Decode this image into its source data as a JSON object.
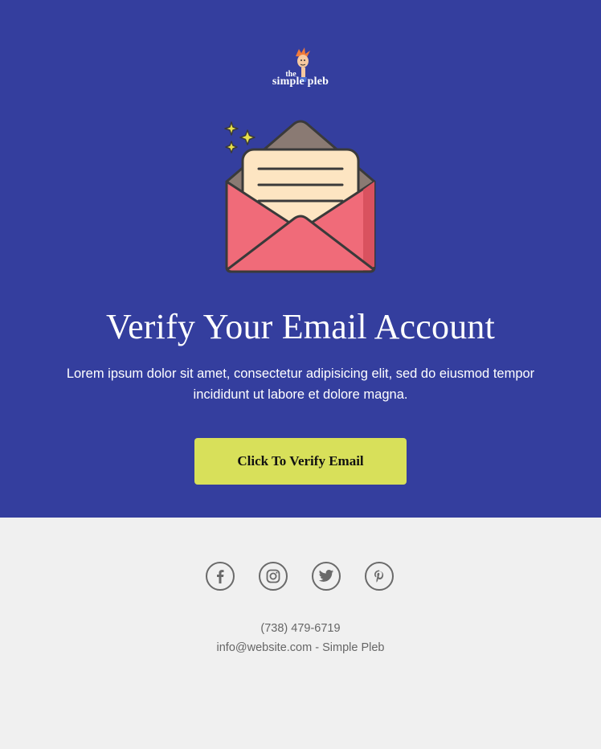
{
  "brand": {
    "logo_small": "the",
    "logo_big": "simple pleb"
  },
  "hero": {
    "title": "Verify Your Email Account",
    "body": "Lorem ipsum dolor sit amet, consectetur adipisicing elit, sed do eiusmod tempor incididunt ut labore et dolore magna.",
    "cta_label": "Click To Verify Email"
  },
  "footer": {
    "social": [
      "facebook-icon",
      "instagram-icon",
      "twitter-icon",
      "pinterest-icon"
    ],
    "phone": "(738) 479-6719",
    "email": "info@website.com",
    "separator": " - ",
    "company": "Simple Pleb"
  },
  "colors": {
    "hero_bg": "#343e9e",
    "cta_bg": "#d8e05a",
    "footer_bg": "#f0f0f0",
    "envelope_red": "#f06b79",
    "letter_cream": "#fde5c2"
  }
}
